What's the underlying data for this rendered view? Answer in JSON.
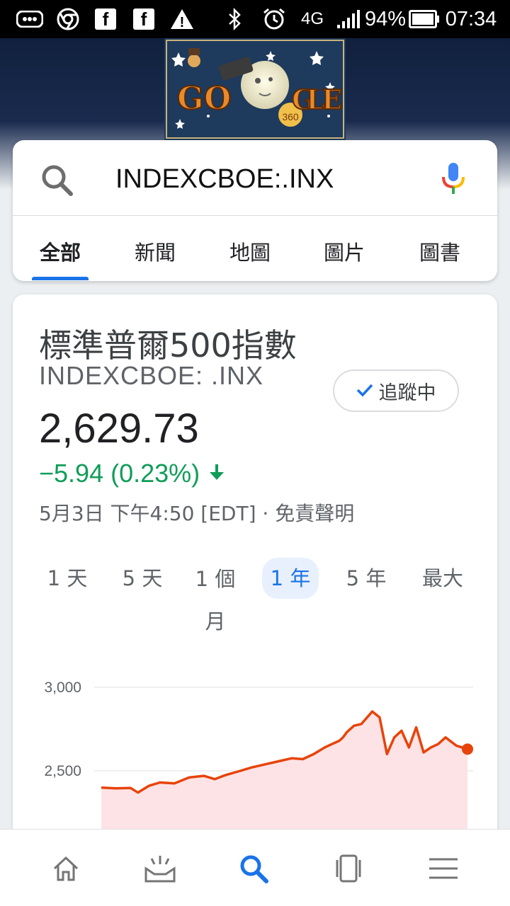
{
  "status_bar": {
    "network": "4G",
    "battery": "94%",
    "time": "07:34",
    "notification_icons": [
      "voicemail-icon",
      "chrome-icon",
      "facebook-icon",
      "facebook-icon",
      "warning-icon"
    ],
    "fb_glyph": "f",
    "warning_glyph": "!"
  },
  "doodle": {
    "letters": [
      "G",
      "O",
      "G",
      "L",
      "E"
    ],
    "badge": "360"
  },
  "search": {
    "query": "INDEXCBOE:.INX",
    "tabs": [
      {
        "label": "全部",
        "active": true
      },
      {
        "label": "新聞"
      },
      {
        "label": "地圖"
      },
      {
        "label": "圖片"
      },
      {
        "label": "圖書"
      }
    ]
  },
  "finance": {
    "name": "標準普爾500指數",
    "ticker": "INDEXCBOE: .INX",
    "follow_label": "追蹤中",
    "price": "2,629.73",
    "change": "−5.94 (0.23%)",
    "change_color": "#0f9d58",
    "timestamp": "5月3日 下午4:50 [EDT] · 免責聲明",
    "ranges": [
      {
        "label": "1 天"
      },
      {
        "label": "5 天"
      },
      {
        "label": "1 個月"
      },
      {
        "label": "1 年",
        "active": true
      },
      {
        "label": "5 年"
      },
      {
        "label": "最大"
      }
    ]
  },
  "chart_data": {
    "type": "area",
    "color": "#e8430a",
    "fill": "#fde3e6",
    "y_ticks": [
      "3,000",
      "2,500"
    ],
    "ylim": [
      2300,
      3000
    ],
    "grid": true,
    "x": [
      0,
      4,
      8,
      10,
      13,
      16,
      20,
      24,
      28,
      31,
      34,
      38,
      41,
      45,
      48,
      52,
      55,
      58,
      61,
      63,
      65,
      66,
      67,
      69,
      71,
      73,
      74,
      76,
      78,
      80,
      82,
      84,
      86,
      88,
      90,
      92,
      94,
      97,
      100
    ],
    "values": [
      2399,
      2395,
      2397,
      2370,
      2410,
      2430,
      2425,
      2460,
      2470,
      2450,
      2475,
      2500,
      2520,
      2540,
      2555,
      2575,
      2570,
      2600,
      2640,
      2660,
      2680,
      2700,
      2730,
      2770,
      2780,
      2830,
      2855,
      2820,
      2600,
      2700,
      2740,
      2640,
      2760,
      2610,
      2640,
      2660,
      2700,
      2650,
      2630
    ]
  },
  "bottom_nav": [
    {
      "name": "home-icon"
    },
    {
      "name": "feed-icon"
    },
    {
      "name": "search-icon",
      "color": "#1a73e8",
      "active": true
    },
    {
      "name": "tabs-icon"
    },
    {
      "name": "menu-icon"
    }
  ]
}
